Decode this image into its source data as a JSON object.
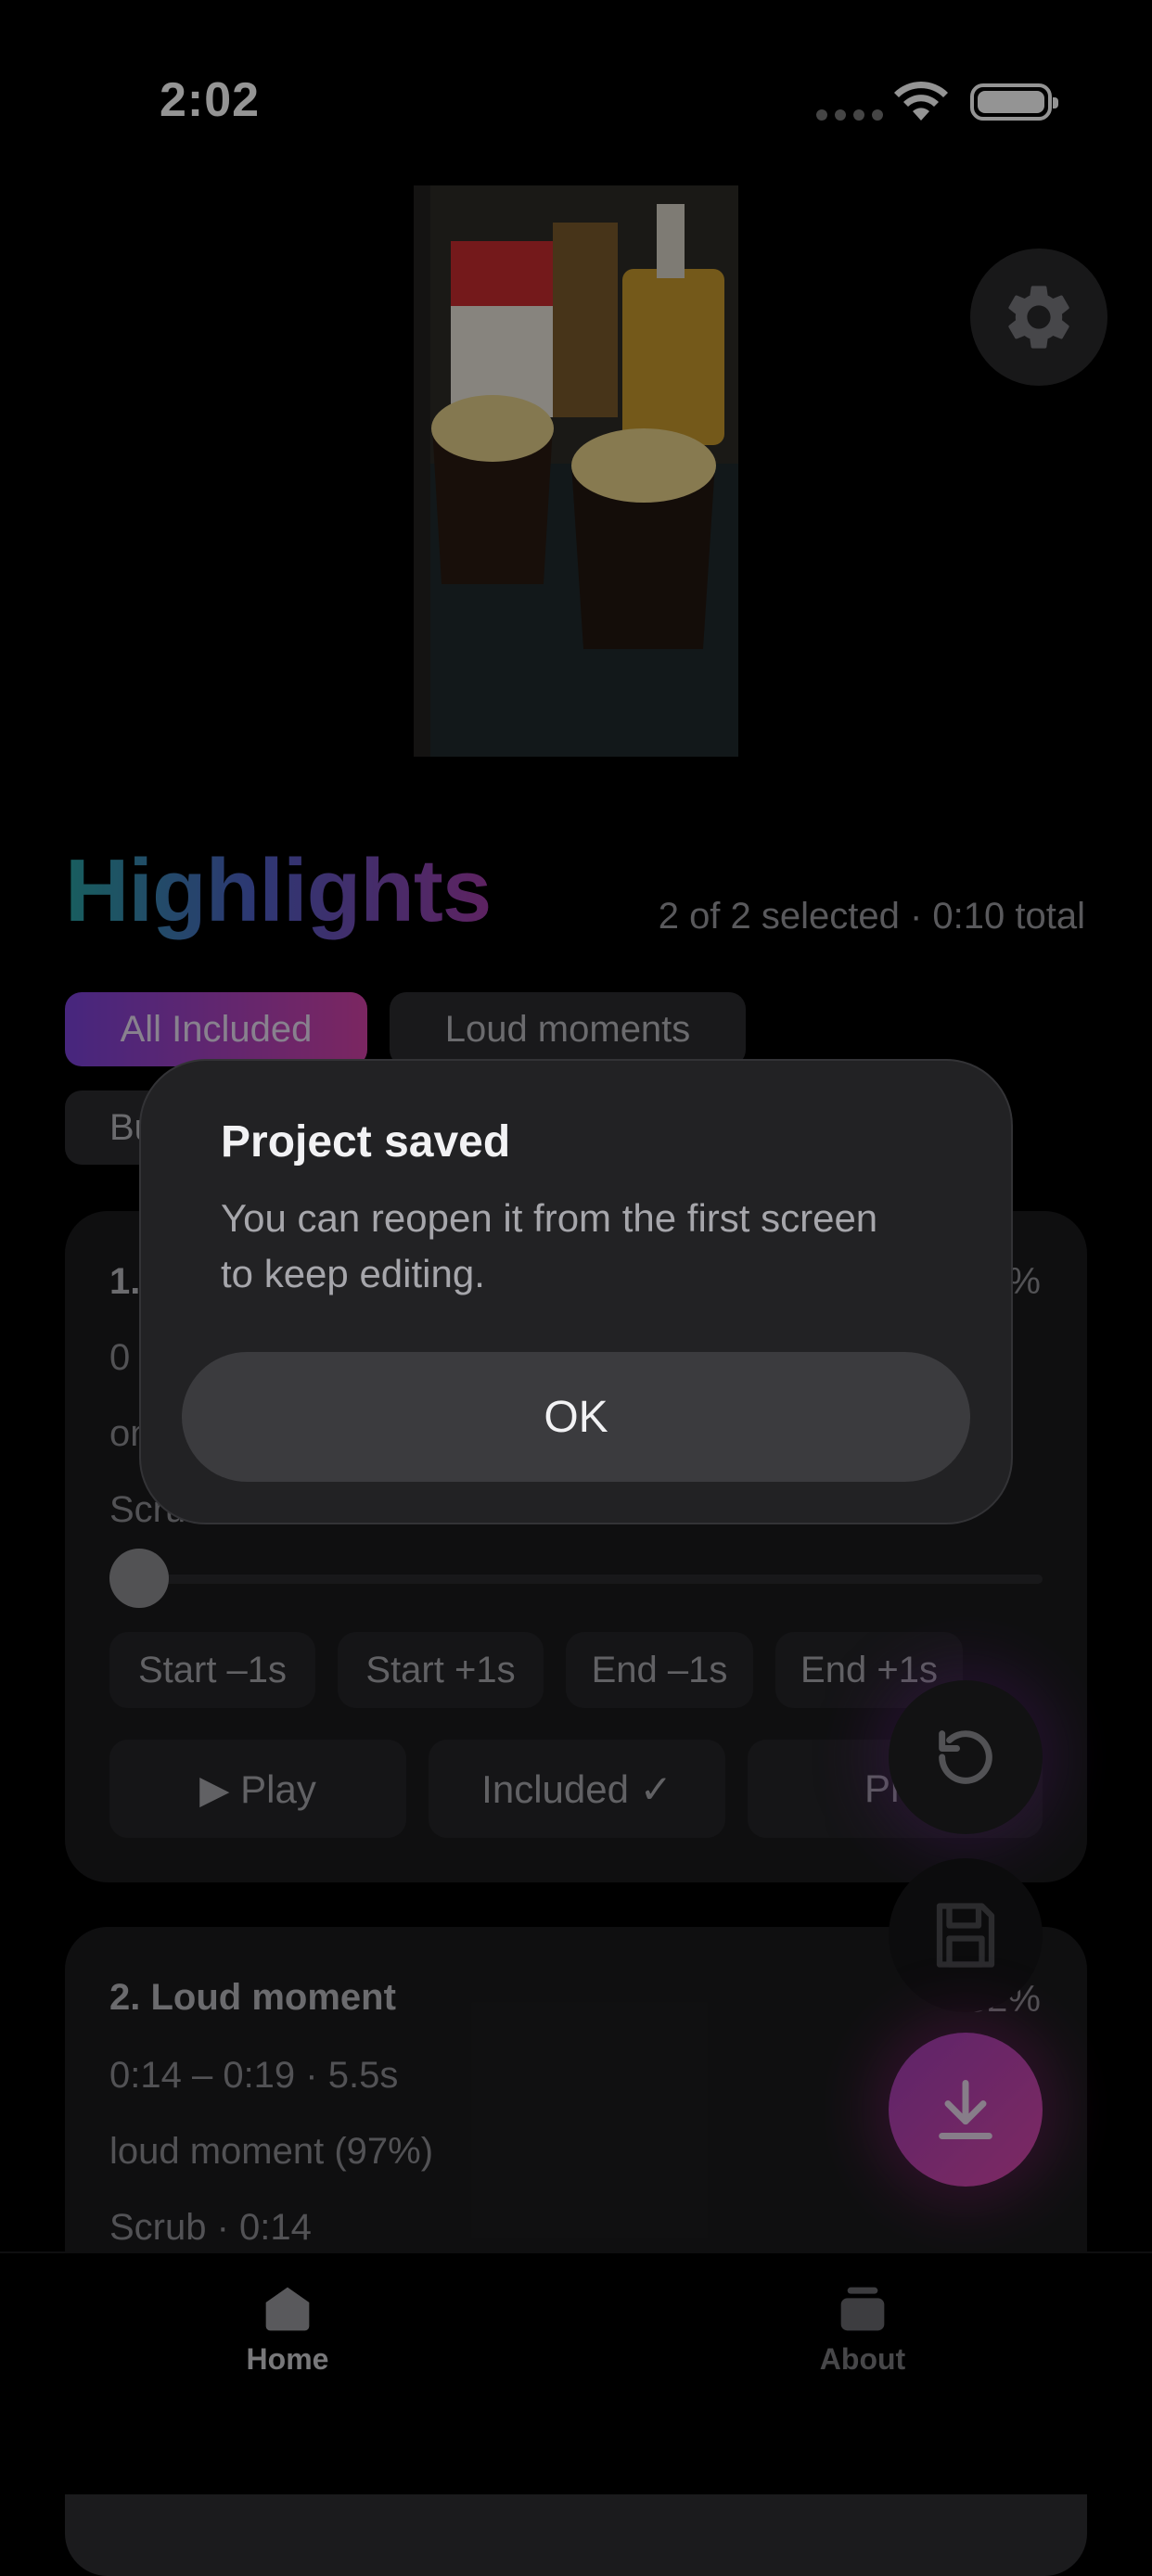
{
  "status_bar": {
    "time": "2:02"
  },
  "header": {
    "title": "Highlights",
    "summary": "2 of 2 selected · 0:10 total"
  },
  "filters": {
    "chips": [
      {
        "label": "All Included",
        "active": true
      },
      {
        "label": "Loud moments",
        "active": false
      },
      {
        "label": "Bu",
        "active": false
      }
    ]
  },
  "clips": [
    {
      "title": "1.",
      "time_range": "0",
      "reason": "on",
      "scrub_label": "Scrub",
      "confidence": "%",
      "trim_buttons": [
        "Start –1s",
        "Start +1s",
        "End –1s",
        "End +1s"
      ],
      "play_label": "▶ Play",
      "included_label": "Included ✓",
      "third_button": "Pr",
      "scrub_position": 0.0
    },
    {
      "title": "2. Loud moment",
      "time_range": "0:14 – 0:19 · 5.5s",
      "reason": "loud moment (97%)",
      "scrub_label": "Scrub · 0:14",
      "confidence": "32%"
    }
  ],
  "fabs": {
    "reset_icon": "rotate-ccw-icon",
    "save_icon": "floppy-disk-icon",
    "download_icon": "download-icon"
  },
  "alert": {
    "title": "Project saved",
    "message": "You can reopen it from the first screen to keep editing.",
    "ok_label": "OK"
  },
  "tabs": [
    {
      "label": "Home",
      "icon": "home-icon",
      "active": true
    },
    {
      "label": "About",
      "icon": "stack-icon",
      "active": false
    }
  ],
  "colors": {
    "background": "#000000",
    "accent_gradient_start": "#7a43d9",
    "accent_gradient_end": "#d442a8",
    "title_gradient": [
      "#2aa3a3",
      "#4f5fc7",
      "#a23ca8"
    ]
  }
}
